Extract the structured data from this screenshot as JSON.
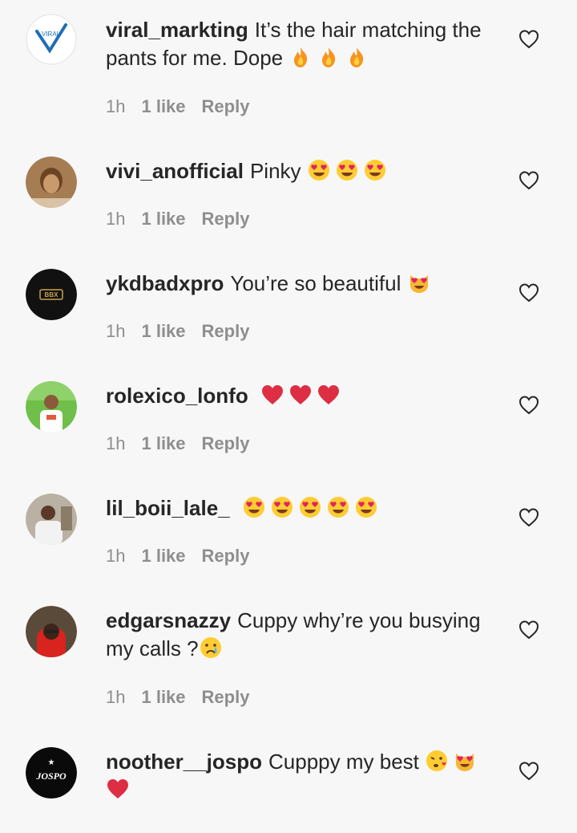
{
  "comments": [
    {
      "username": "viral_markting",
      "text": "It’s the hair matching the pants for me. Dope",
      "emojis": [
        "fire-emoji",
        "fire-emoji",
        "fire-emoji"
      ],
      "time": "1h",
      "likes": "1 like",
      "reply": "Reply",
      "avatar_label": "VIRAL",
      "avatar_style": "logo-v"
    },
    {
      "username": "vivi_anofficial",
      "text": "Pinky",
      "emojis": [
        "heart-eyes-emoji",
        "heart-eyes-emoji",
        "heart-eyes-emoji"
      ],
      "time": "1h",
      "likes": "1 like",
      "reply": "Reply",
      "avatar_style": "photo-warm"
    },
    {
      "username": "ykdbadxpro",
      "text": "You’re so beautiful",
      "emojis": [
        "heart-eyes-cat-emoji"
      ],
      "time": "1h",
      "likes": "1 like",
      "reply": "Reply",
      "avatar_label": "BBX",
      "avatar_style": "logo-dark"
    },
    {
      "username": "rolexico_lonfo",
      "text": "",
      "emojis": [
        "red-heart-emoji",
        "red-heart-emoji",
        "red-heart-emoji"
      ],
      "time": "1h",
      "likes": "1 like",
      "reply": "Reply",
      "avatar_style": "photo-green"
    },
    {
      "username": "lil_boii_lale_",
      "text": "",
      "emojis": [
        "heart-eyes-emoji",
        "heart-eyes-emoji",
        "heart-eyes-emoji",
        "heart-eyes-emoji",
        "heart-eyes-emoji"
      ],
      "time": "1h",
      "likes": "1 like",
      "reply": "Reply",
      "avatar_style": "photo-grey"
    },
    {
      "username": "edgarsnazzy",
      "text": "Cuppy why’re you busying my calls ?",
      "emojis": [
        "crying-emoji"
      ],
      "time": "1h",
      "likes": "1 like",
      "reply": "Reply",
      "avatar_style": "photo-red"
    },
    {
      "username": "noother__jospo",
      "text": "Cupppy my best",
      "emojis": [
        "kiss-emoji",
        "heart-eyes-cat-emoji",
        "red-heart-emoji"
      ],
      "time": "",
      "likes": "",
      "reply": "",
      "avatar_label": "JOSPO",
      "avatar_style": "logo-black"
    }
  ],
  "icons": {
    "like": "heart-outline-icon"
  },
  "colors": {
    "background": "#f7f7f7",
    "text": "#262626",
    "meta": "#8e8e8e",
    "heart_red": "#e0245e"
  }
}
